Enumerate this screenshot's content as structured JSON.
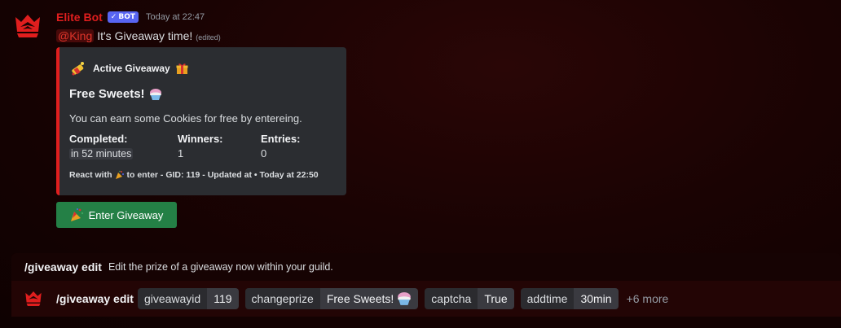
{
  "message": {
    "author": "Elite Bot",
    "badge": "BOT",
    "timestamp": "Today at 22:47",
    "mention": "@King",
    "text": "It's Giveaway time!",
    "edited": "(edited)"
  },
  "embed": {
    "accent_color": "#e01e1e",
    "author": "Active Giveaway",
    "title": "Free Sweets!",
    "description": "You can earn some Cookies for free by entereing.",
    "fields": [
      {
        "name": "Completed:",
        "value": "in 52 minutes"
      },
      {
        "name": "Winners:",
        "value": "1"
      },
      {
        "name": "Entries:",
        "value": "0"
      }
    ],
    "footer_prefix": "React with",
    "footer_suffix": "to enter - GID: 119 - Updated at • Today at 22:50"
  },
  "button": {
    "label": "Enter Giveaway",
    "color": "#248046"
  },
  "command_hint": {
    "name": "/giveaway edit",
    "description": "Edit the prize of a giveaway now within your guild."
  },
  "command_bar": {
    "name": "/giveaway edit",
    "options": [
      {
        "key": "giveawayid",
        "value": "119"
      },
      {
        "key": "changeprize",
        "value": "Free Sweets!"
      },
      {
        "key": "captcha",
        "value": "True"
      },
      {
        "key": "addtime",
        "value": "30min"
      }
    ],
    "more": "+6 more"
  },
  "icons": [
    "crown-logo-icon",
    "bot-check-icon",
    "gift-icon",
    "shaved-ice-icon",
    "party-popper-icon",
    "firecracker-icon"
  ]
}
